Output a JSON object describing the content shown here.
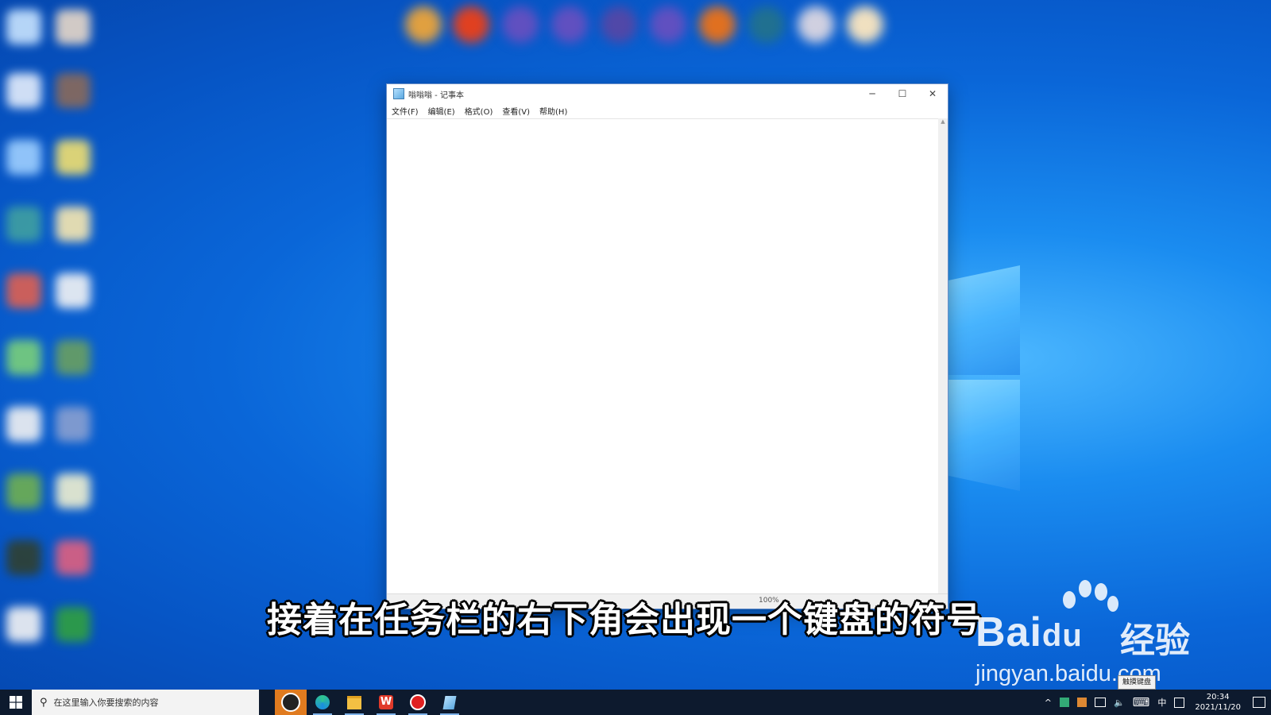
{
  "notepad": {
    "title": "嗡嗡嗡 - 记事本",
    "controls": {
      "minimize": "─",
      "maximize": "☐",
      "close": "✕"
    },
    "menus": [
      "文件(F)",
      "编辑(E)",
      "格式(O)",
      "查看(V)",
      "帮助(H)"
    ],
    "content": "",
    "status_zoom": "100%"
  },
  "subtitle": "接着在任务栏的右下角会出现一个键盘的符号",
  "watermark": {
    "brand": "Bai",
    "brand_du": "du",
    "cn": "经验",
    "url": "jingyan.baidu.com"
  },
  "tooltip": "触摸键盘",
  "taskbar": {
    "search_placeholder": "在这里输入你要搜索的内容",
    "apps": [
      "user-avatar-app",
      "edge-browser",
      "file-explorer",
      "wps-office",
      "screen-recorder",
      "notepad"
    ],
    "tray": {
      "chevron": "^",
      "ime": "中",
      "keyboard": "⌨"
    },
    "clock": {
      "time": "20:34",
      "date": "2021/11/20"
    }
  },
  "colors": {
    "desktop": "#0a66d8",
    "taskbar": "#0d1a2e",
    "active_app": "#e07b1f"
  }
}
